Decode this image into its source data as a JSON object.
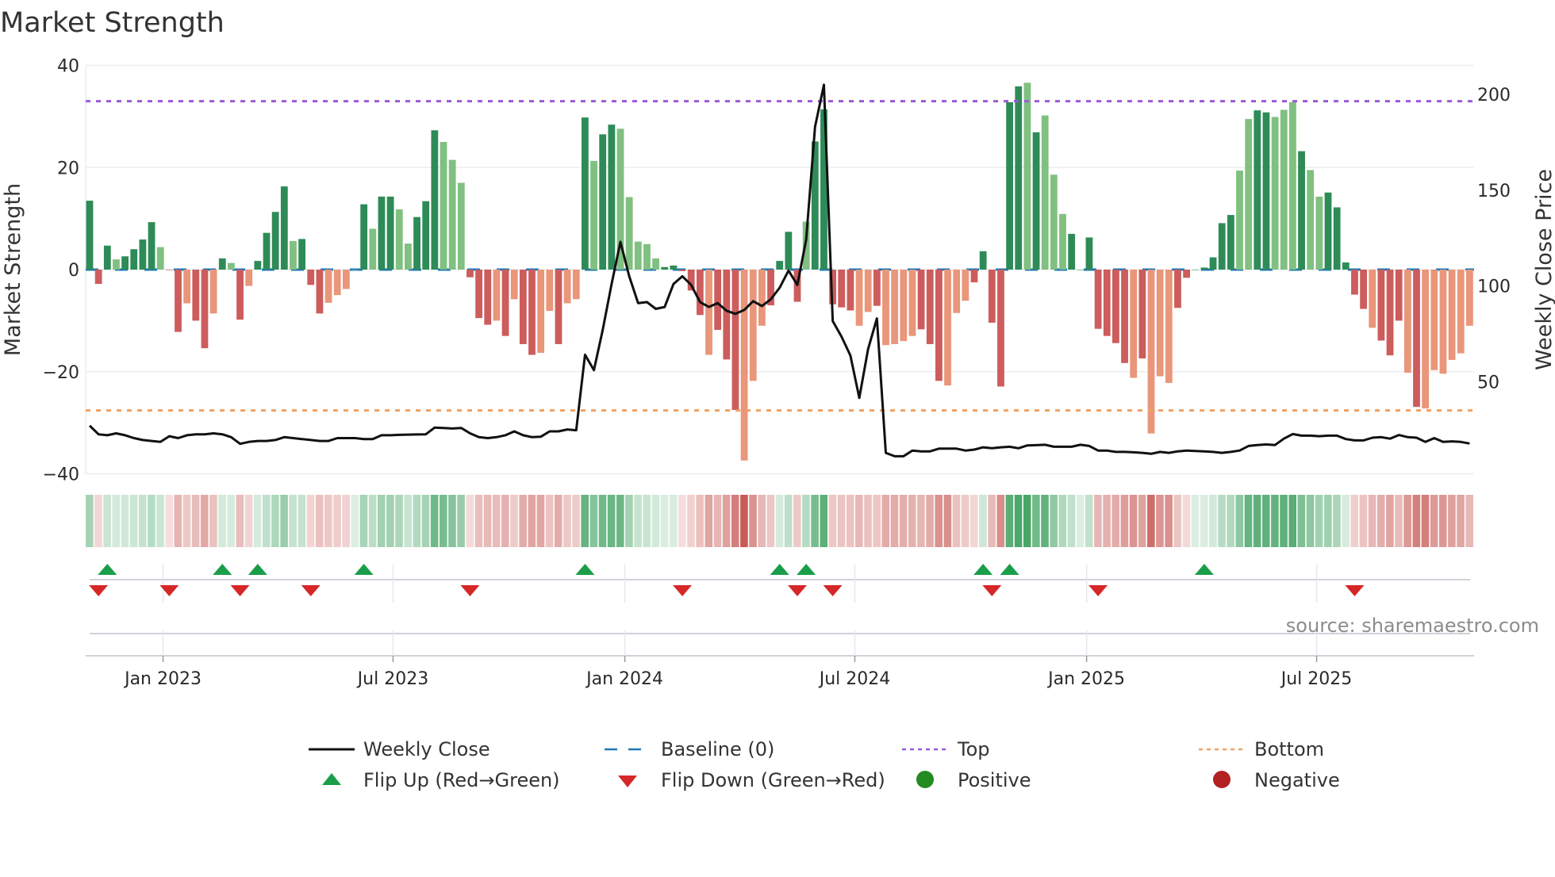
{
  "chart_data": {
    "type": "bar",
    "title": "Market Strength",
    "ylabel": "Market Strength",
    "y2label": "Weekly Close Price",
    "ylim": [
      -40,
      40
    ],
    "y2lim": [
      1.5,
      214.5
    ],
    "yticks": [
      40,
      20,
      0,
      -20,
      -40
    ],
    "yticklabels": [
      "40",
      "20",
      "0",
      "−20",
      "−40"
    ],
    "y2ticks": [
      200,
      150,
      100,
      50
    ],
    "y2ticklabels": [
      "200",
      "150",
      "100",
      "50"
    ],
    "xticks": [
      {
        "label": "Jan 2023",
        "week": 8.3
      },
      {
        "label": "Jul 2023",
        "week": 34.3
      },
      {
        "label": "Jan 2024",
        "week": 60.5
      },
      {
        "label": "Jul 2024",
        "week": 86.5
      },
      {
        "label": "Jan 2025",
        "week": 112.7
      },
      {
        "label": "Jul 2025",
        "week": 138.7
      }
    ],
    "top_level": 33.0,
    "bottom_level": -27.6,
    "baseline": 0,
    "strength": [
      13.5,
      -2.8,
      4.7,
      2,
      2.6,
      4,
      5.9,
      9.3,
      4.4,
      -0.1,
      -12.2,
      -6.6,
      -10,
      -15.4,
      -8.6,
      2.2,
      1.3,
      -9.8,
      -3.2,
      1.7,
      7.2,
      11.3,
      16.3,
      5.6,
      6,
      -3,
      -8.6,
      -6.5,
      -5,
      -3.8,
      0,
      12.8,
      8,
      14.3,
      14.3,
      11.8,
      5.1,
      10.3,
      13.4,
      27.3,
      25,
      21.5,
      17,
      -1.5,
      -9.5,
      -10.8,
      -10,
      -13,
      -5.8,
      -14.6,
      -16.7,
      -16.3,
      -8.1,
      -14.6,
      -6.6,
      -5.8,
      29.8,
      21.3,
      26.5,
      28.4,
      27.6,
      14.2,
      5.5,
      5,
      2.2,
      0.5,
      0.8,
      -0.3,
      -4.1,
      -8.9,
      -16.7,
      -11.8,
      -17.6,
      -27.5,
      -37.4,
      -21.8,
      -11,
      -7,
      1.7,
      7.4,
      -6.3,
      9.4,
      25.1,
      31.4,
      -6.8,
      -7.4,
      -8,
      -11,
      -8.3,
      -7.1,
      -14.8,
      -14.6,
      -14,
      -13,
      -11.7,
      -14.6,
      -21.8,
      -22.7,
      -8.5,
      -6.1,
      -2.5,
      3.6,
      -10.4,
      -22.9,
      32.8,
      35.9,
      36.6,
      26.9,
      30.2,
      18.6,
      10.9,
      7,
      0,
      6.3,
      -11.6,
      -13,
      -14.4,
      -18.3,
      -21.2,
      -17.4,
      -32.1,
      -20.9,
      -22.2,
      -7.5,
      -1.6,
      0,
      0.4,
      2.4,
      9.1,
      10.7,
      19.4,
      29.5,
      31.2,
      30.8,
      29.9,
      31.3,
      32.8,
      23.2,
      19.5,
      14.3,
      15.1,
      12.2,
      1.4,
      -4.9,
      -7.7,
      -11.4,
      -13.9,
      -16.8,
      -10,
      -20.2,
      -26.9,
      -27.2,
      -19.7,
      -20.4,
      -17.7,
      -16.4,
      -11
    ],
    "shade": "DDDLDDDDLDDLDDLDLDLDDDDLDDDLLLLDLDDLLDDDLLLDDDLDLDDLLDLLDLDDLLLLLDDDDDLDDDLLLDDDDLDDDDDLLDLLLLDDDLLLDDDDDDLDLLLDDDDDDDLDLLLDDDDDDDLLDDLLLDLLDDDDDLDDDLDLLL",
    "weekly_close": [
      27,
      22.5,
      22,
      23,
      22,
      20.5,
      19.5,
      19,
      18.5,
      21.5,
      20.5,
      22,
      22.5,
      22.5,
      23,
      22.5,
      21,
      17.5,
      18.5,
      19,
      19,
      19.5,
      21,
      20.5,
      20,
      19.5,
      19,
      19,
      20.5,
      20.5,
      20.5,
      20,
      20,
      22,
      22,
      22.2,
      22.3,
      22.4,
      22.5,
      26,
      25.8,
      25.5,
      25.8,
      23,
      21,
      20.5,
      21,
      22,
      24,
      22,
      21,
      21.2,
      24,
      24,
      25,
      24.6,
      64,
      56,
      77,
      101,
      123,
      105,
      91,
      91.5,
      88,
      89,
      101,
      105,
      100.5,
      91.5,
      89,
      91,
      87,
      85.4,
      87.4,
      92,
      89.5,
      93,
      99,
      108,
      100.5,
      124,
      183,
      205,
      81.6,
      73.4,
      63.6,
      41.5,
      67,
      83,
      12.8,
      11,
      11,
      14,
      13.6,
      13.6,
      15,
      15,
      15,
      14,
      14.5,
      15.7,
      15.2,
      15.7,
      16,
      15.2,
      16.7,
      16.8,
      17,
      16,
      16,
      16,
      17,
      16.4,
      14,
      14,
      13.3,
      13.3,
      13.1,
      12.8,
      12.3,
      13.3,
      12.8,
      13.6,
      14,
      13.8,
      13.6,
      13.3,
      12.8,
      13.3,
      14,
      16.4,
      16.9,
      17.2,
      16.9,
      20.2,
      22.6,
      21.8,
      21.8,
      21.5,
      21.8,
      21.8,
      20,
      19.3,
      19.3,
      20.7,
      21,
      20.2,
      22.1,
      21,
      20.7,
      18.5,
      20.5,
      18.5,
      18.8,
      18.5,
      17.7
    ],
    "flip_up_weeks": [
      2,
      15,
      19,
      31,
      56,
      78,
      81,
      101,
      104,
      126
    ],
    "flip_down_weeks": [
      1,
      9,
      17,
      25,
      43,
      67,
      80,
      84,
      102,
      114,
      143
    ],
    "legend": {
      "placement": "bottom",
      "items": [
        {
          "key": "close",
          "label": "Weekly Close"
        },
        {
          "key": "baseline",
          "label": "Baseline (0)"
        },
        {
          "key": "top",
          "label": "Top"
        },
        {
          "key": "bottom",
          "label": "Bottom"
        },
        {
          "key": "flip_up",
          "label": "Flip Up (Red→Green)"
        },
        {
          "key": "flip_down",
          "label": "Flip Down (Green→Red)"
        },
        {
          "key": "positive",
          "label": "Positive"
        },
        {
          "key": "negative",
          "label": "Negative"
        }
      ]
    },
    "source": "source: sharemaestro.com"
  },
  "colors": {
    "pos_dark": "#2e8b57",
    "pos_light": "#80c080",
    "neg_dark": "#cd5c5c",
    "neg_light": "#e9967a",
    "baseline": "#1f77b4",
    "top": "#9b59d6",
    "bottom": "#f0a060",
    "close": "#111111",
    "flip_up": "#1a9e4a",
    "flip_down": "#d62728",
    "positive": "#228b22",
    "negative": "#b22222"
  }
}
